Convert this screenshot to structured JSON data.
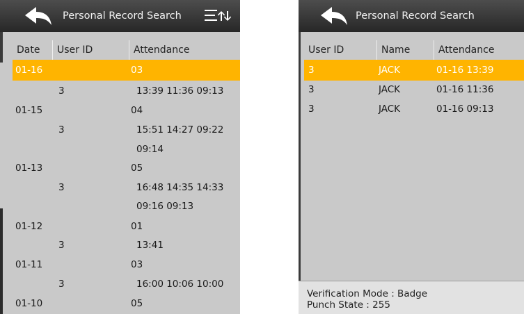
{
  "left_screen": {
    "title": "Personal Record Search",
    "columns": [
      "Date",
      "User ID",
      "Attendance"
    ],
    "rows": [
      {
        "date": "01-16",
        "user_id": "",
        "attendance": "03",
        "selected": true
      },
      {
        "date": "",
        "user_id": "3",
        "attendance": "13:39 11:36 09:13"
      },
      {
        "date": "01-15",
        "user_id": "",
        "attendance": "04"
      },
      {
        "date": "",
        "user_id": "3",
        "attendance": "15:51 14:27 09:22"
      },
      {
        "date": "",
        "user_id": "",
        "attendance": "09:14"
      },
      {
        "date": "01-13",
        "user_id": "",
        "attendance": "05"
      },
      {
        "date": "",
        "user_id": "3",
        "attendance": "16:48 14:35 14:33"
      },
      {
        "date": "",
        "user_id": "",
        "attendance": "09:16 09:13"
      },
      {
        "date": "01-12",
        "user_id": "",
        "attendance": "01"
      },
      {
        "date": "",
        "user_id": "3",
        "attendance": "13:41"
      },
      {
        "date": "01-11",
        "user_id": "",
        "attendance": "03"
      },
      {
        "date": "",
        "user_id": "3",
        "attendance": "16:00 10:06 10:00"
      },
      {
        "date": "01-10",
        "user_id": "",
        "attendance": "05"
      }
    ]
  },
  "right_screen": {
    "title": "Personal Record Search",
    "columns": [
      "User ID",
      "Name",
      "Attendance"
    ],
    "rows": [
      {
        "user_id": "3",
        "name": "JACK",
        "attendance": "01-16 13:39",
        "selected": true
      },
      {
        "user_id": "3",
        "name": "JACK",
        "attendance": "01-16 11:36"
      },
      {
        "user_id": "3",
        "name": "JACK",
        "attendance": "01-16 09:13"
      }
    ],
    "footer": {
      "verification_mode": "Verification Mode : Badge",
      "punch_state": "Punch State : 255"
    }
  },
  "colors": {
    "selected_row": "#ffb400",
    "title_bar": "#333333",
    "background": "#c9c9c9"
  }
}
